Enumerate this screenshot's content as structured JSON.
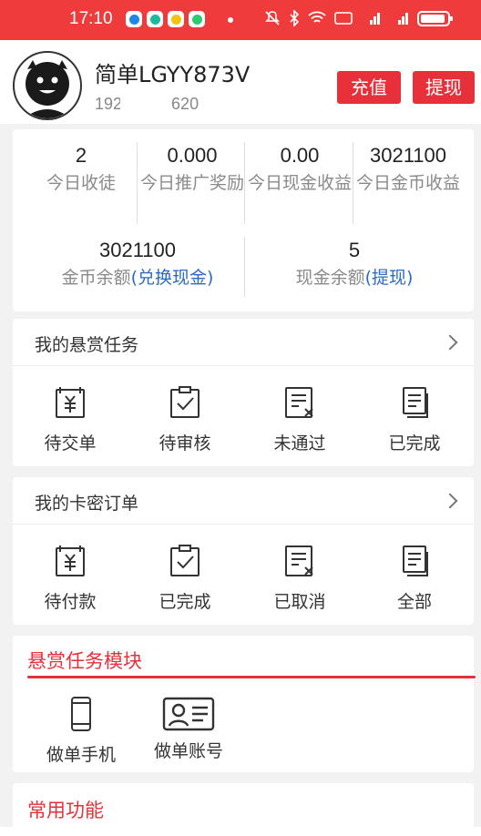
{
  "status": {
    "time": "17:10",
    "app_colors": [
      "#1f88e5",
      "#1abc9c",
      "#f1c40f",
      "#2ecc71"
    ],
    "indicators": "5G 4G"
  },
  "profile": {
    "username": "简单LGYY873V",
    "phone_prefix": "192",
    "phone_suffix": "620",
    "recharge_label": "充值",
    "withdraw_label": "提现"
  },
  "stats": {
    "row1": [
      {
        "value": "2",
        "label": "今日收徒"
      },
      {
        "value": "0.000",
        "label": "今日推广奖励"
      },
      {
        "value": "0.00",
        "label": "今日现金收益"
      },
      {
        "value": "3021100",
        "label": "今日金币收益"
      }
    ],
    "coin_balance": {
      "value": "3021100",
      "label": "金币余额",
      "link": "(兑换现金)"
    },
    "cash_balance": {
      "value": "5",
      "label": "现金余额",
      "link": "(提现)"
    }
  },
  "bounty_tasks": {
    "title": "我的悬赏任务",
    "items": [
      {
        "label": "待交单",
        "icon": "yuan-doc-icon"
      },
      {
        "label": "待审核",
        "icon": "check-clipboard-icon"
      },
      {
        "label": "未通过",
        "icon": "rejected-doc-icon"
      },
      {
        "label": "已完成",
        "icon": "done-stack-icon"
      }
    ]
  },
  "card_orders": {
    "title": "我的卡密订单",
    "items": [
      {
        "label": "待付款",
        "icon": "yuan-doc-icon"
      },
      {
        "label": "已完成",
        "icon": "check-clipboard-icon"
      },
      {
        "label": "已取消",
        "icon": "cancelled-doc-icon"
      },
      {
        "label": "全部",
        "icon": "all-stack-icon"
      }
    ]
  },
  "bounty_module": {
    "title": "悬赏任务模块",
    "items": [
      {
        "label": "做单手机",
        "icon": "mobile-phone-icon"
      },
      {
        "label": "做单账号",
        "icon": "id-card-icon"
      }
    ]
  },
  "common": {
    "title": "常用功能"
  },
  "colors": {
    "brand_red": "#e8303a",
    "link_blue": "#2b6bc4"
  }
}
